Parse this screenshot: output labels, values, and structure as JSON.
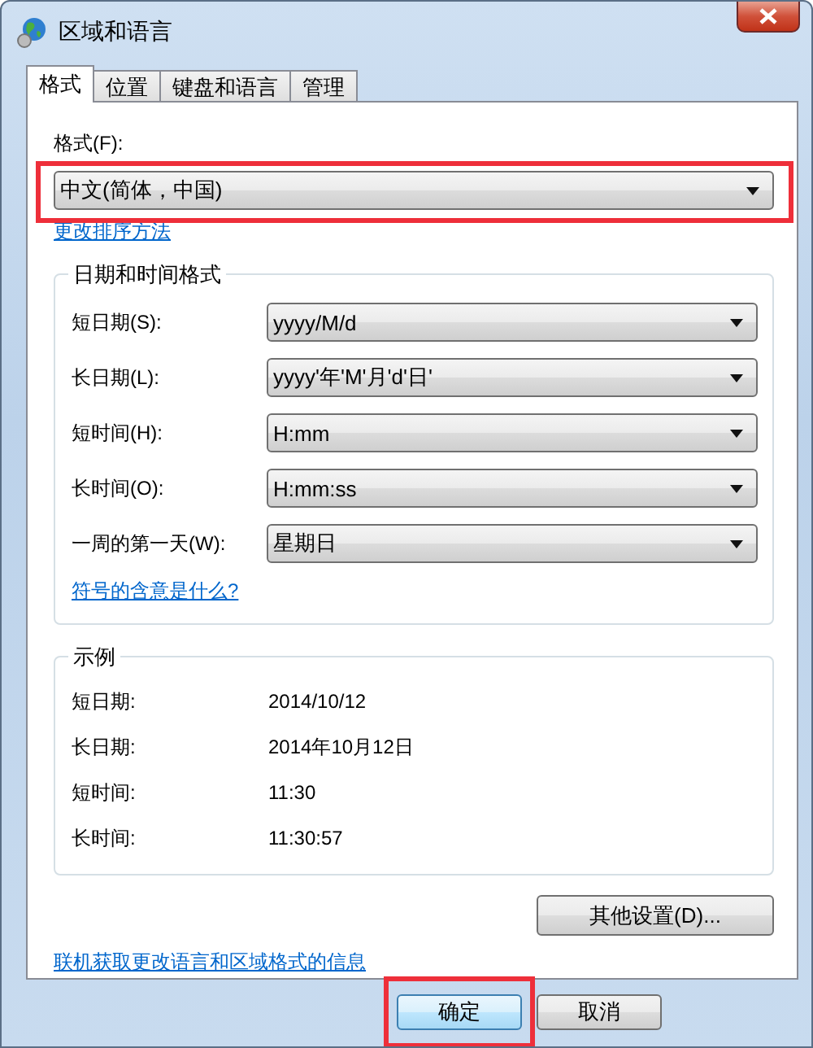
{
  "window": {
    "title": "区域和语言"
  },
  "tabs": [
    {
      "label": "格式",
      "selected": true
    },
    {
      "label": "位置",
      "selected": false
    },
    {
      "label": "键盘和语言",
      "selected": false
    },
    {
      "label": "管理",
      "selected": false
    }
  ],
  "format": {
    "label": "格式(F):",
    "value": "中文(简体，中国)",
    "highlighted": true
  },
  "sort_link": "更改排序方法",
  "date_time_formats": {
    "title": "日期和时间格式",
    "rows": [
      {
        "label": "短日期(S):",
        "value": "yyyy/M/d"
      },
      {
        "label": "长日期(L):",
        "value": "yyyy'年'M'月'd'日'"
      },
      {
        "label": "短时间(H):",
        "value": "H:mm"
      },
      {
        "label": "长时间(O):",
        "value": "H:mm:ss"
      },
      {
        "label": "一周的第一天(W):",
        "value": "星期日"
      }
    ],
    "link": "符号的含意是什么?"
  },
  "examples": {
    "title": "示例",
    "rows": [
      {
        "label": "短日期:",
        "value": "2014/10/12"
      },
      {
        "label": "长日期:",
        "value": "2014年10月12日"
      },
      {
        "label": "短时间:",
        "value": "11:30"
      },
      {
        "label": "长时间:",
        "value": "11:30:57"
      }
    ]
  },
  "other_settings_button": "其他设置(D)...",
  "online_link": "联机获取更改语言和区域格式的信息",
  "buttons": [
    {
      "label": "确定",
      "highlighted": true
    },
    {
      "label": "取消",
      "highlighted": false
    }
  ]
}
